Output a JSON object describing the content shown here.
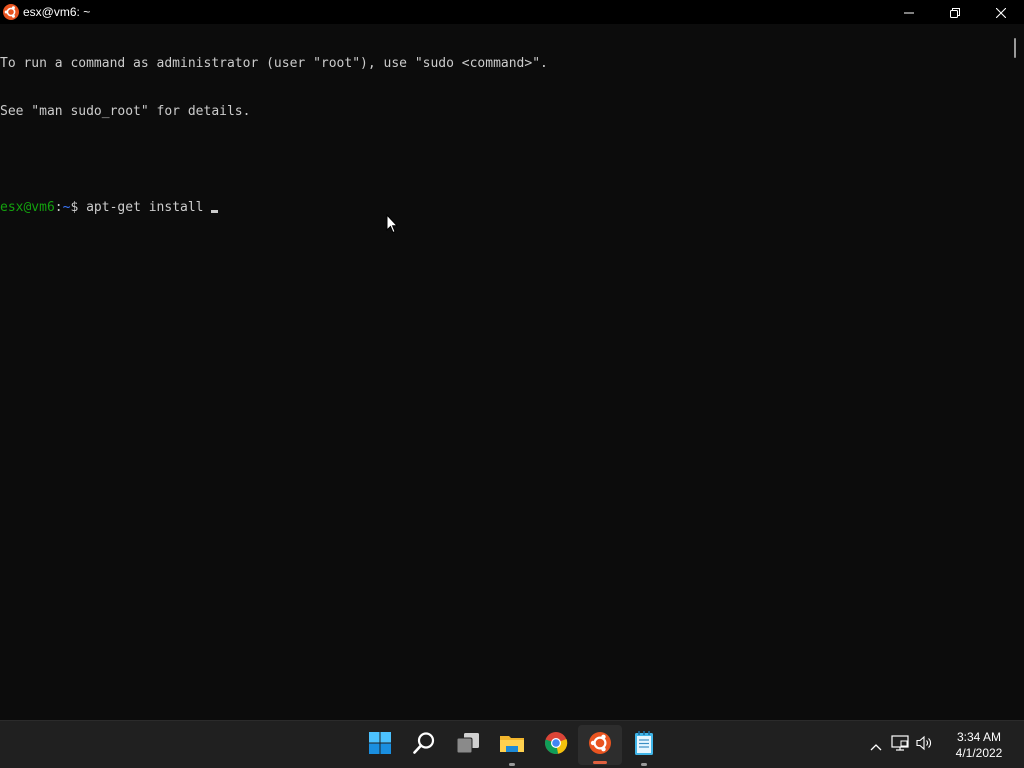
{
  "window": {
    "title": "esx@vm6: ~",
    "icon": "ubuntu-icon"
  },
  "window_controls": {
    "minimize": "minimize-icon",
    "maximize": "restore-icon",
    "close": "close-icon"
  },
  "terminal": {
    "lines": [
      "To run a command as administrator (user \"root\"), use \"sudo <command>\".",
      "See \"man sudo_root\" for details.",
      ""
    ],
    "prompt": {
      "user_host": "esx@vm6",
      "separator": ":",
      "path": "~",
      "symbol": "$ ",
      "command": "apt-get install "
    },
    "colors": {
      "background": "#0c0c0c",
      "text": "#cccccc",
      "user": "#13a10e",
      "path": "#3b78ff"
    }
  },
  "taskbar": {
    "apps": [
      {
        "name": "start-button",
        "icon": "windows-icon"
      },
      {
        "name": "search-button",
        "icon": "search-icon"
      },
      {
        "name": "task-view-button",
        "icon": "task-view-icon"
      },
      {
        "name": "file-explorer-button",
        "icon": "folder-icon",
        "running": true
      },
      {
        "name": "chrome-button",
        "icon": "chrome-icon"
      },
      {
        "name": "ubuntu-button",
        "icon": "ubuntu-icon",
        "running": true,
        "active": true
      },
      {
        "name": "notepad-button",
        "icon": "notepad-icon",
        "running": true
      }
    ],
    "tray": {
      "icons": [
        "chevron-up-icon",
        "network-icon",
        "volume-icon"
      ],
      "time": "3:34 AM",
      "date": "4/1/2022"
    }
  }
}
